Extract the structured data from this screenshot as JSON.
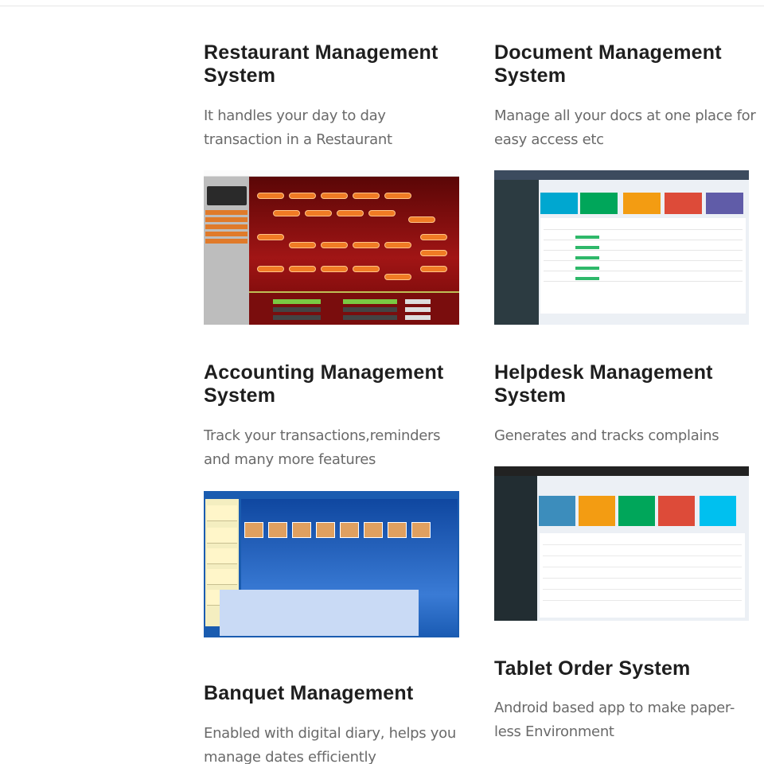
{
  "products": [
    {
      "title": "Restaurant Management System",
      "description": "It handles your day to day transaction in a Restaurant"
    },
    {
      "title": "Document Management System",
      "description": "Manage all your docs at one place for easy access etc"
    },
    {
      "title": "Accounting Management System",
      "description": "Track your transactions,reminders and many more features"
    },
    {
      "title": "Helpdesk Management System",
      "description": "Generates and tracks complains"
    },
    {
      "title": "Banquet Management",
      "description": "Enabled with digital diary, helps you manage dates efficiently"
    },
    {
      "title": "Tablet Order System",
      "description": "Android based app to make paper-less Environment"
    }
  ],
  "colors": {
    "heading": "#1e1e1e",
    "body_text": "#6a6a6a",
    "restaurant_accent": "#f07b24",
    "document_tiles": [
      "#00a7d0",
      "#00a65a",
      "#f39c12",
      "#dd4b39",
      "#605ca8"
    ],
    "helpdesk_tiles": [
      "#3c8dbc",
      "#f39c12",
      "#00a65a",
      "#dd4b39",
      "#00c0ef"
    ]
  }
}
